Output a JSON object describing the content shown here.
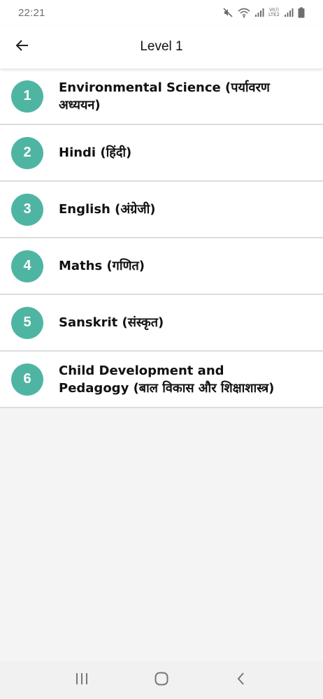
{
  "status_bar": {
    "time": "22:21",
    "lte_label_top": "Vo))",
    "lte_label_bottom": "LTE2"
  },
  "header": {
    "title": "Level 1"
  },
  "subjects": [
    {
      "number": "1",
      "label": "Environmental Science (पर्यावरण अध्ययन)"
    },
    {
      "number": "2",
      "label": "Hindi (हिंदी)"
    },
    {
      "number": "3",
      "label": "English (अंग्रेजी)"
    },
    {
      "number": "4",
      "label": "Maths (गणित)"
    },
    {
      "number": "5",
      "label": "Sanskrit (संस्कृत)"
    },
    {
      "number": "6",
      "label": "Child Development and Pedagogy (बाल विकास और शिक्षाशास्त्र)"
    }
  ],
  "colors": {
    "badge": "#4fb5a3",
    "background": "#f4f4f4",
    "divider": "#dcdcdc"
  },
  "icons": {
    "back": "arrow-left-icon",
    "mute": "mute-icon",
    "wifi": "wifi-icon",
    "signal": "signal-icon",
    "battery": "battery-icon",
    "recents": "recents-icon",
    "home": "home-icon",
    "nav_back": "chevron-left-icon"
  }
}
